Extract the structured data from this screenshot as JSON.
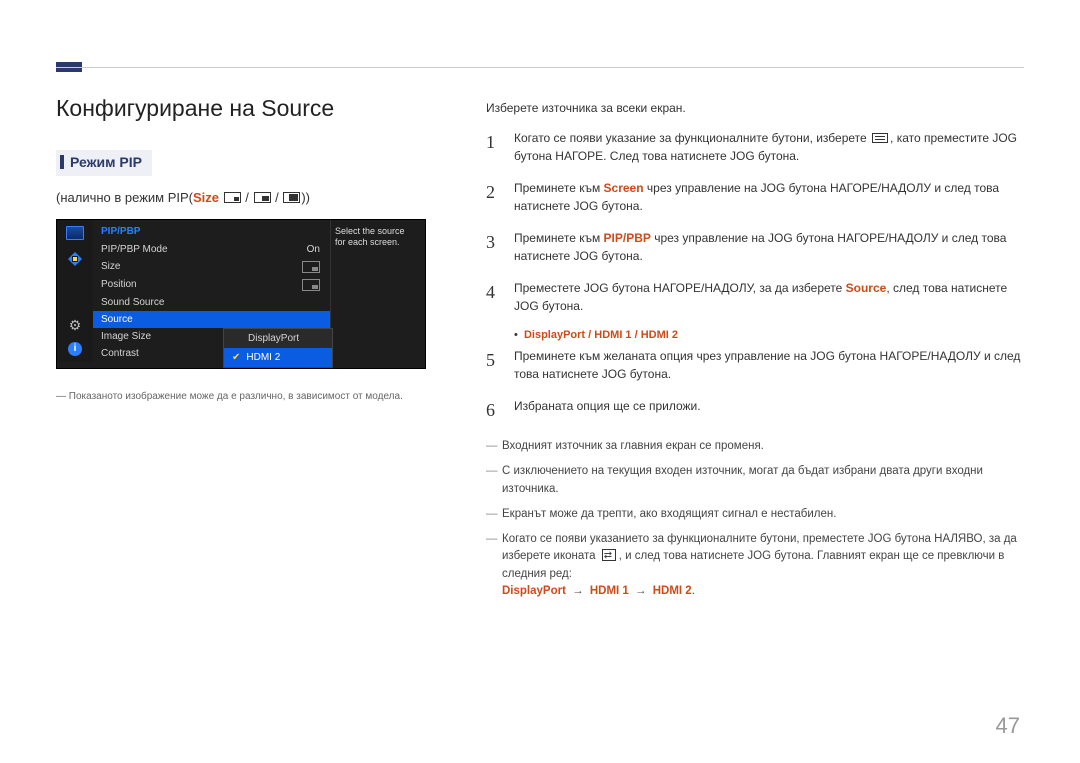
{
  "page_number": "47",
  "title": "Конфигуриране на Source",
  "mode_label": "Режим PIP",
  "availability": {
    "prefix": "(налично в режим PIP(",
    "size_word": "Size",
    "suffix": "))"
  },
  "osd": {
    "header": "PIP/PBP",
    "tip_line1": "Select the source",
    "tip_line2": "for each screen.",
    "items": [
      {
        "label": "PIP/PBP Mode",
        "value": "On"
      },
      {
        "label": "Size",
        "value": ""
      },
      {
        "label": "Position",
        "value": ""
      },
      {
        "label": "Sound Source",
        "value": ""
      },
      {
        "label": "Source",
        "value": ""
      },
      {
        "label": "Image Size",
        "value": ""
      },
      {
        "label": "Contrast",
        "value": ""
      }
    ],
    "submenu": {
      "opt1": "DisplayPort",
      "opt2": "HDMI 2"
    }
  },
  "footnote": "Показаното изображение може да е различно, в зависимост от модела.",
  "intro": "Изберете източника за всеки екран.",
  "steps": {
    "s1a": "Когато се появи указание за функционалните бутони, изберете ",
    "s1b": ", като преместите JOG бутона НАГОРЕ. След това натиснете JOG бутона.",
    "s2a": "Преминете към ",
    "s2_hl": "Screen",
    "s2b": " чрез управление на JOG бутона НАГОРЕ/НАДОЛУ и след това натиснете JOG бутона.",
    "s3a": "Преминете към ",
    "s3_hl": "PIP/PBP",
    "s3b": " чрез управление на JOG бутона НАГОРЕ/НАДОЛУ и след това натиснете JOG бутона.",
    "s4a": "Преместете JOG бутона НАГОРЕ/НАДОЛУ, за да изберете ",
    "s4_hl": "Source",
    "s4b": ", след това натиснете JOG бутона.",
    "options_line": "DisplayPort / HDMI 1 / HDMI 2",
    "s5": "Преминете към желаната опция чрез управление на JOG бутона НАГОРЕ/НАДОЛУ и след това натиснете JOG бутона.",
    "s6": "Избраната опция ще се приложи."
  },
  "notes": {
    "n1": "Входният източник за главния екран се променя.",
    "n2": "С изключението на текущия входен източник, могат да бъдат избрани двата други входни източника.",
    "n3": "Екранът може да трепти, ако входящият сигнал е нестабилен.",
    "n4a": "Когато се появи указанието за функционалните бутони, преместете JOG бутона НАЛЯВО, за да изберете иконата ",
    "n4b": ", и след това натиснете JOG бутона. Главният екран ще се превключи в следния ред:",
    "seq1": "DisplayPort",
    "seq2": "HDMI 1",
    "seq3": "HDMI 2",
    "arrow": "→"
  }
}
